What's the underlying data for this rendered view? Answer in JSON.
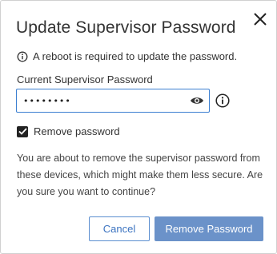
{
  "dialog": {
    "title": "Update Supervisor Password",
    "close_icon": "close-icon",
    "notice": {
      "icon": "info-icon",
      "text": "A reboot is required to update the password."
    },
    "password_field": {
      "label": "Current Supervisor Password",
      "value": "••••••••",
      "toggle_icon": "eye-icon",
      "info_icon": "info-icon"
    },
    "remove_checkbox": {
      "label": "Remove password",
      "checked": true
    },
    "message": "You are about to remove the supervisor password from these devices, which might make them less secure. Are you sure you want to continue?",
    "buttons": {
      "cancel": "Cancel",
      "confirm": "Remove Password"
    }
  },
  "colors": {
    "accent": "#3b7fd1",
    "primary_button": "#6b92c9",
    "text": "#333333"
  }
}
